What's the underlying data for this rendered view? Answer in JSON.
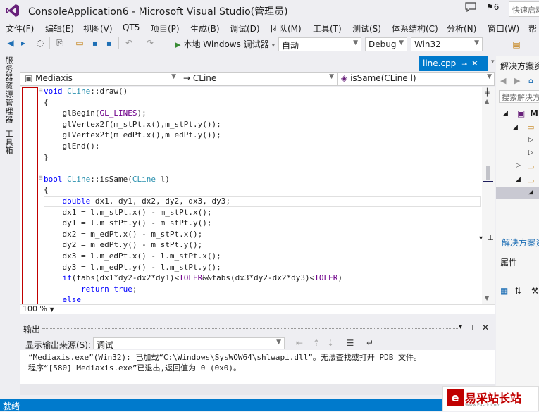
{
  "window": {
    "title": "ConsoleApplication6 - Microsoft Visual Studio(管理员)",
    "notification_count": "6",
    "quick_launch_placeholder": "快速启动"
  },
  "menu": [
    "文件(F)",
    "编辑(E)",
    "视图(V)",
    "QT5",
    "项目(P)",
    "生成(B)",
    "调试(D)",
    "团队(M)",
    "工具(T)",
    "测试(S)",
    "体系结构(C)",
    "分析(N)",
    "窗口(W)",
    "帮"
  ],
  "toolbar": {
    "run_label": "本地 Windows 调试器",
    "config_auto": "自动",
    "config_debug": "Debug",
    "platform": "Win32"
  },
  "left_tabs": [
    "服务器资源管理器",
    "工具箱"
  ],
  "editor": {
    "tab_name": "line.cpp",
    "nav_scope": "Mediaxis",
    "nav_class": "CLine",
    "nav_member": "isSame(CLine l)",
    "zoom": "100 %"
  },
  "code_lines": [
    "void CLine::draw()",
    "{",
    "    glBegin(GL_LINES);",
    "    glVertex2f(m_stPt.x(),m_stPt.y());",
    "    glVertex2f(m_edPt.x(),m_edPt.y());",
    "    glEnd();",
    "}",
    "",
    "bool CLine::isSame(CLine l)",
    "{",
    "    double dx1, dy1, dx2, dy2, dx3, dy3;",
    "    dx1 = l.m_stPt.x() - m_stPt.x();",
    "    dy1 = l.m_stPt.y() - m_stPt.y();",
    "    dx2 = m_edPt.x() - m_stPt.x();",
    "    dy2 = m_edPt.y() - m_stPt.y();",
    "    dx3 = l.m_edPt.x() - l.m_stPt.x();",
    "    dy3 = l.m_edPt.y() - l.m_stPt.y();",
    "    if(fabs(dx1*dy2-dx2*dy1)<TOLER&&fabs(dx3*dy2-dx2*dy3)<TOLER)",
    "        return true;",
    "    else"
  ],
  "output": {
    "title": "输出",
    "source_label": "显示输出来源(S):",
    "source_value": "调试",
    "lines": [
      "“Mediaxis.exe”(Win32): 已加载“C:\\Windows\\SysWOW64\\shlwapi.dll”。无法查找或打开 PDB 文件。",
      "程序“[580] Mediaxis.exe”已退出,返回值为 0 (0x0)。"
    ]
  },
  "right_panel": {
    "title": "解决方案资",
    "search": "搜索解决方",
    "item": "Mi",
    "footer": "解决方案资",
    "properties": "属性"
  },
  "status": "就绪",
  "watermark": {
    "name": "易采站长站",
    "sub": "Www.Easck.Com"
  },
  "colors": {
    "accent": "#007acc",
    "highlight_box": "#c00000"
  }
}
